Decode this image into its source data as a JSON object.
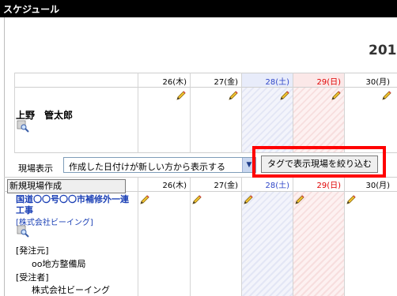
{
  "window": {
    "title": "スケジュール"
  },
  "header": {
    "year": "201"
  },
  "days": [
    {
      "label": "26(木)",
      "color": "#000000"
    },
    {
      "label": "27(金)",
      "color": "#000000"
    },
    {
      "label": "28(土)",
      "color": "#2f46c8"
    },
    {
      "label": "29(日)",
      "color": "#e00000"
    },
    {
      "label": "30(月)",
      "color": "#000000"
    }
  ],
  "person": {
    "name": "上野　管太郎"
  },
  "filter": {
    "label": "現場表示",
    "selected": "作成した日付けが新しい方から表示する",
    "tag_button": "タグで表示現場を絞り込む"
  },
  "sites": {
    "new_button": "新規現場作成",
    "item": {
      "title": "国道〇〇号〇〇市補修外一連工事",
      "company_link": "[株式会社ビーイング]",
      "ordering_label": "[発注元]",
      "ordering_value": "oo地方整備局",
      "contractor_label": "[受注者]",
      "contractor_value": "株式会社ビーイング"
    }
  },
  "colors": {
    "weekday_saturday": "#2f46c8",
    "weekday_sunday": "#e00000",
    "highlight": "#ff0000",
    "link": "#1a3fb5"
  }
}
